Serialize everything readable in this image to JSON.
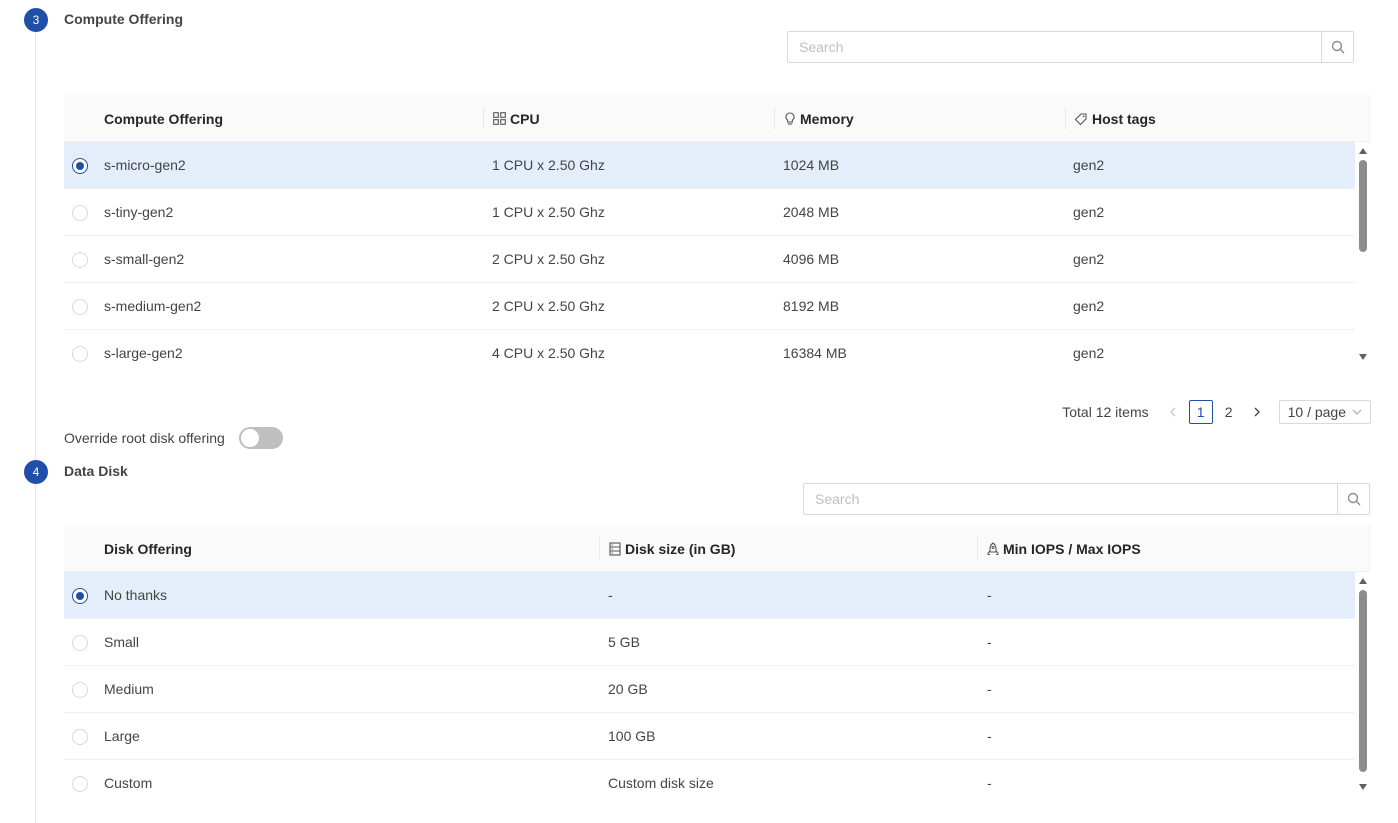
{
  "steps": [
    {
      "number": "3",
      "title": "Compute Offering"
    },
    {
      "number": "4",
      "title": "Data Disk"
    }
  ],
  "compute": {
    "search_placeholder": "Search",
    "columns": {
      "name": "Compute Offering",
      "cpu": "CPU",
      "memory": "Memory",
      "host_tags": "Host tags"
    },
    "rows": [
      {
        "name": "s-micro-gen2",
        "cpu": "1 CPU x 2.50 Ghz",
        "memory": "1024 MB",
        "host_tags": "gen2",
        "selected": true
      },
      {
        "name": "s-tiny-gen2",
        "cpu": "1 CPU x 2.50 Ghz",
        "memory": "2048 MB",
        "host_tags": "gen2",
        "selected": false
      },
      {
        "name": "s-small-gen2",
        "cpu": "2 CPU x 2.50 Ghz",
        "memory": "4096 MB",
        "host_tags": "gen2",
        "selected": false
      },
      {
        "name": "s-medium-gen2",
        "cpu": "2 CPU x 2.50 Ghz",
        "memory": "8192 MB",
        "host_tags": "gen2",
        "selected": false
      },
      {
        "name": "s-large-gen2",
        "cpu": "4 CPU x 2.50 Ghz",
        "memory": "16384 MB",
        "host_tags": "gen2",
        "selected": false
      }
    ],
    "pagination": {
      "total": "Total 12 items",
      "pages": [
        "1",
        "2"
      ],
      "current_page": "1",
      "page_size": "10 / page"
    }
  },
  "override_root_disk": {
    "label": "Override root disk offering",
    "enabled": false
  },
  "disk": {
    "search_placeholder": "Search",
    "columns": {
      "name": "Disk Offering",
      "size": "Disk size (in GB)",
      "iops": "Min IOPS / Max IOPS"
    },
    "rows": [
      {
        "name": "No thanks",
        "size": "-",
        "iops": "-",
        "selected": true
      },
      {
        "name": "Small",
        "size": "5 GB",
        "iops": "-",
        "selected": false
      },
      {
        "name": "Medium",
        "size": "20 GB",
        "iops": "-",
        "selected": false
      },
      {
        "name": "Large",
        "size": "100 GB",
        "iops": "-",
        "selected": false
      },
      {
        "name": "Custom",
        "size": "Custom disk size",
        "iops": "-",
        "selected": false
      }
    ]
  },
  "colors": {
    "accent": "#1f4fa8",
    "selected_row": "#e3eefa"
  }
}
